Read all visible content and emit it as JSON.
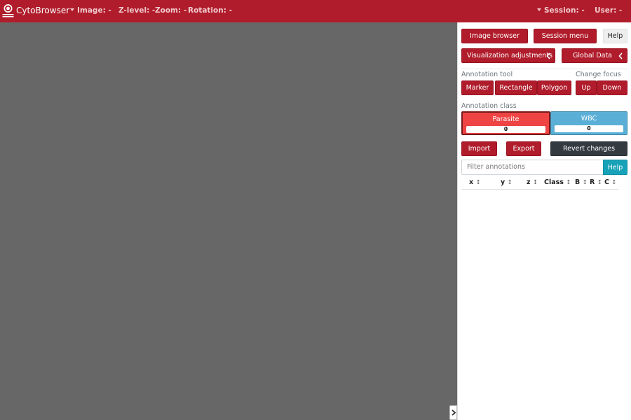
{
  "app": {
    "brand": "CytoBrowser",
    "logo_text": "UPPSALA UNIVERSITET",
    "icon": "uppsala-seal-icon"
  },
  "navbar": {
    "image_label": "Image: -",
    "zlevel_label": "Z-level: -",
    "zoom_label": "Zoom: -",
    "rotation_label": "Rotation: -",
    "session_label": "Session: -",
    "user_label": "User: -"
  },
  "colors": {
    "brand_red": "#b01c2b",
    "viewer_gray": "#676767",
    "parasite_red": "#ef4444",
    "wbc_blue": "#5aafd6",
    "help_cyan": "#17a2b8",
    "dark_button": "#333a40"
  },
  "sidebar": {
    "image_browser": "Image browser",
    "session_menu": "Session menu",
    "help": "Help",
    "visualization_adjustments": "Visualization adjustments",
    "global_data": "Global Data",
    "annotation_tool_label": "Annotation tool",
    "tools": [
      "Marker",
      "Rectangle",
      "Polygon"
    ],
    "change_focus_label": "Change focus",
    "focus_up": "Up",
    "focus_down": "Down",
    "annotation_class_label": "Annotation class",
    "classes": [
      {
        "name": "Parasite",
        "count": "0",
        "color": "#ef4444",
        "selected": true
      },
      {
        "name": "WBC",
        "count": "0",
        "color": "#5aafd6",
        "selected": false
      }
    ],
    "import": "Import",
    "export": "Export",
    "revert": "Revert changes",
    "filter_placeholder": "Filter annotations",
    "filter_help": "Help",
    "table_headers": [
      "x",
      "y",
      "z",
      "Class",
      "B",
      "R",
      "C"
    ],
    "sort_glyph": "↕"
  }
}
